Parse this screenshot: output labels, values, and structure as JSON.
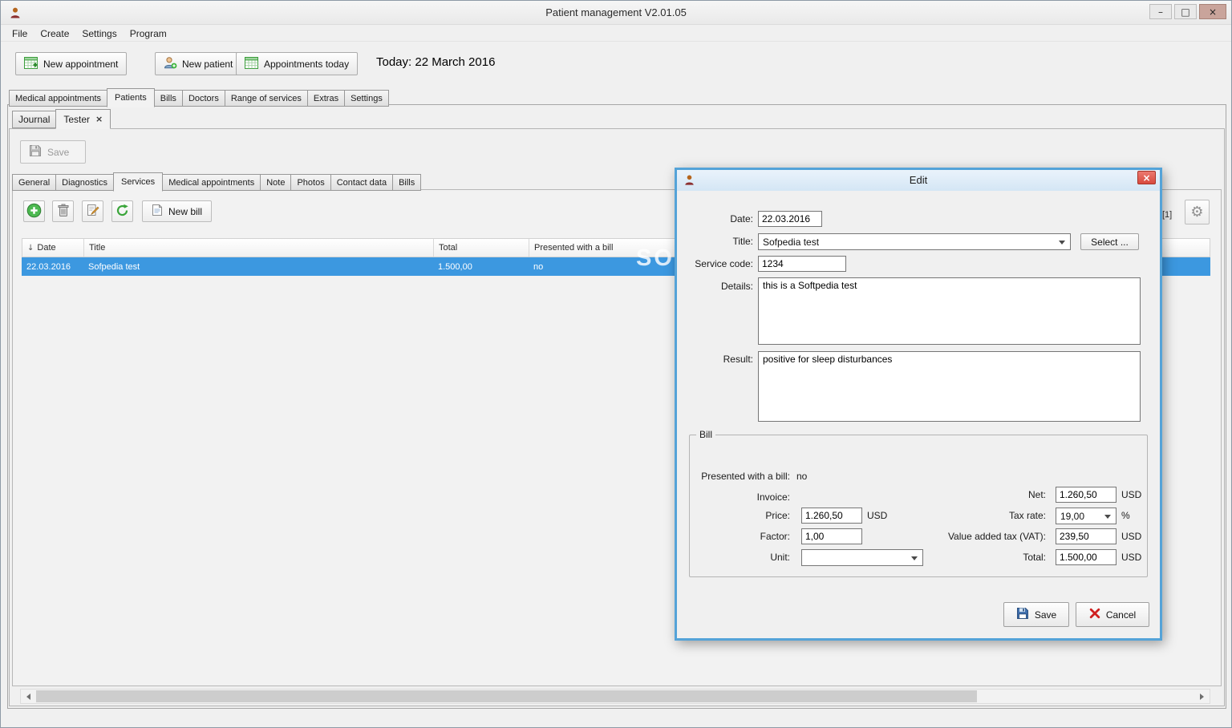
{
  "colors": {
    "selection_blue": "#3c98e0",
    "dialog_border_blue": "#54a3d8",
    "dialog_close_red": "#d84a3e"
  },
  "titlebar": {
    "title": "Patient management V2.01.05",
    "minimize_glyph": "–",
    "maximize_glyph": "□",
    "close_glyph": "×"
  },
  "menubar": {
    "items": [
      {
        "label": "File"
      },
      {
        "label": "Create"
      },
      {
        "label": "Settings"
      },
      {
        "label": "Program"
      }
    ]
  },
  "toolbar": {
    "new_appointment_label": "New appointment",
    "new_patient_label": "New patient",
    "appointments_today_label": "Appointments today",
    "today_text": "Today: 22 March 2016"
  },
  "main_tabs": {
    "active": "Patients",
    "items": [
      {
        "label": "Medical appointments"
      },
      {
        "label": "Patients"
      },
      {
        "label": "Bills"
      },
      {
        "label": "Doctors"
      },
      {
        "label": "Range of services"
      },
      {
        "label": "Extras"
      },
      {
        "label": "Settings"
      }
    ]
  },
  "patient_tabs": {
    "active": "Tester",
    "close_glyph": "×",
    "items": [
      {
        "label": "Journal"
      },
      {
        "label": "Tester"
      }
    ]
  },
  "patient_toolbar": {
    "save_label": "Save"
  },
  "detail_tabs": {
    "active": "Services",
    "items": [
      {
        "label": "General"
      },
      {
        "label": "Diagnostics"
      },
      {
        "label": "Services"
      },
      {
        "label": "Medical appointments"
      },
      {
        "label": "Note"
      },
      {
        "label": "Photos"
      },
      {
        "label": "Contact data"
      },
      {
        "label": "Bills"
      }
    ]
  },
  "services_toolbar": {
    "new_bill_label": "New bill",
    "record_count": "[1]"
  },
  "services_table": {
    "sort_glyph": "↓",
    "columns": [
      {
        "label": "Date"
      },
      {
        "label": "Title"
      },
      {
        "label": "Total"
      },
      {
        "label": "Presented with a bill"
      }
    ],
    "rows": [
      {
        "date": "22.03.2016",
        "title": "Sofpedia test",
        "total": "1.500,00",
        "presented_with_bill": "no"
      }
    ]
  },
  "watermark": "SOFTPEDIA",
  "edit_dialog": {
    "title": "Edit",
    "close_glyph": "×",
    "date_label": "Date:",
    "date_value": "22.03.2016",
    "title_label": "Title:",
    "title_value": "Sofpedia test",
    "select_button_label": "Select ...",
    "service_code_label": "Service code:",
    "service_code_value": "1234",
    "details_label": "Details:",
    "details_value": "this is a Softpedia test",
    "result_label": "Result:",
    "result_value": "positive for sleep disturbances",
    "bill": {
      "group_label": "Bill",
      "presented_label": "Presented with a bill:",
      "presented_value": "no",
      "invoice_label": "Invoice:",
      "price_label": "Price:",
      "price_value": "1.260,50",
      "price_currency": "USD",
      "factor_label": "Factor:",
      "factor_value": "1,00",
      "unit_label": "Unit:",
      "unit_value": "",
      "net_label": "Net:",
      "net_value": "1.260,50",
      "net_currency": "USD",
      "tax_rate_label": "Tax rate:",
      "tax_rate_value": "19,00",
      "tax_rate_unit": "%",
      "vat_label": "Value added tax (VAT):",
      "vat_value": "239,50",
      "vat_currency": "USD",
      "total_label": "Total:",
      "total_value": "1.500,00",
      "total_currency": "USD"
    },
    "save_label": "Save",
    "cancel_label": "Cancel"
  }
}
